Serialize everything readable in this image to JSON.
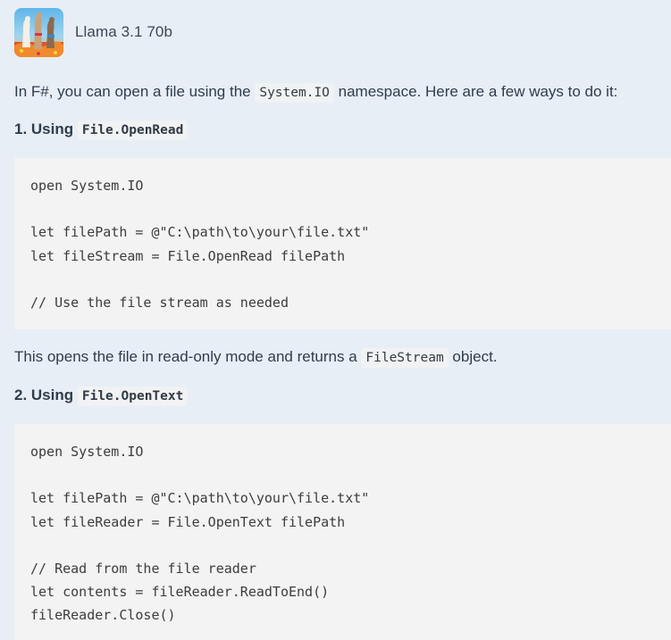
{
  "header": {
    "model_name": "Llama 3.1 70b"
  },
  "intro": {
    "before": "In F#, you can open a file using the ",
    "code": "System.IO",
    "after": " namespace. Here are a few ways to do it:"
  },
  "section1": {
    "heading_text": "1. Using ",
    "heading_code": "File.OpenRead",
    "code_lines": [
      "open System.IO",
      "",
      "let filePath = @\"C:\\path\\to\\your\\file.txt\"",
      "let fileStream = File.OpenRead filePath",
      "",
      "// Use the file stream as needed"
    ],
    "desc_before": "This opens the file in read-only mode and returns a ",
    "desc_code": "FileStream",
    "desc_after": " object."
  },
  "section2": {
    "heading_text": "2. Using ",
    "heading_code": "File.OpenText",
    "code_lines": [
      "open System.IO",
      "",
      "let filePath = @\"C:\\path\\to\\your\\file.txt\"",
      "let fileReader = File.OpenText filePath",
      "",
      "// Read from the file reader",
      "let contents = fileReader.ReadToEnd()",
      "fileReader.Close()"
    ]
  },
  "colors": {
    "page_background": "#e8eef6",
    "code_background": "#f3f3f3",
    "text": "#2f3c4b"
  }
}
